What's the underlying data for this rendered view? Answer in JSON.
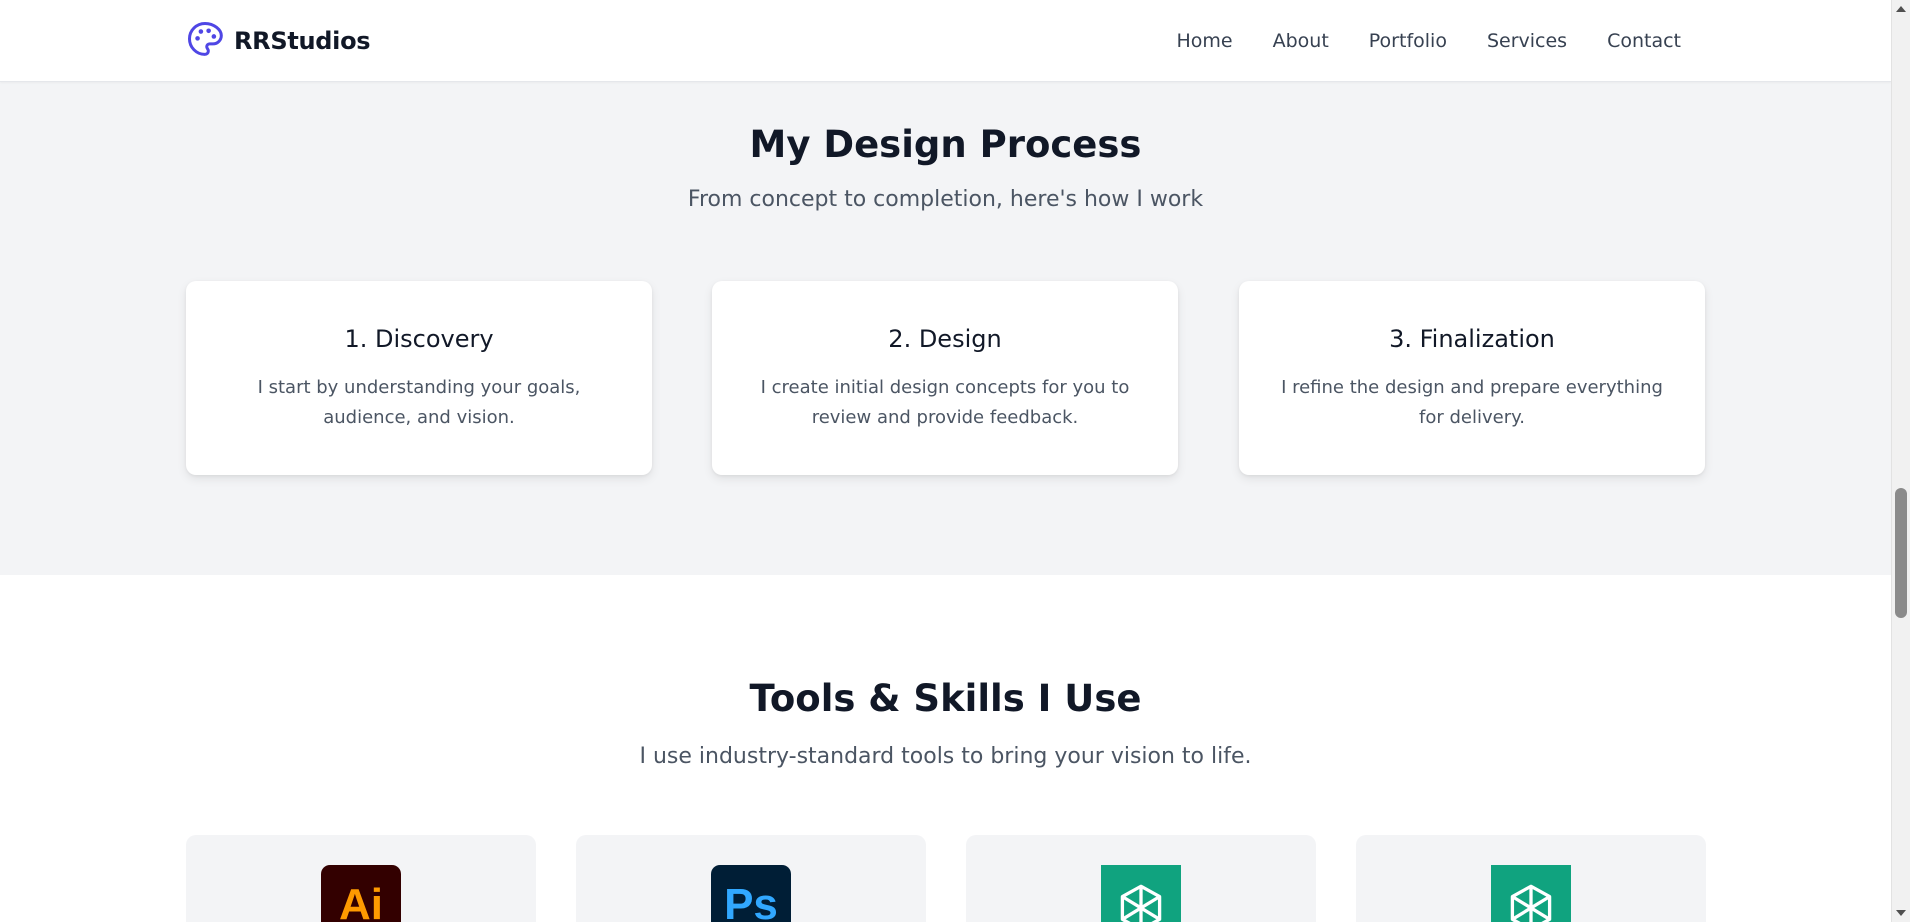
{
  "brand": {
    "name": "RRStudios",
    "icon": "palette-icon",
    "accent": "#4f46e5"
  },
  "nav": {
    "links": [
      "Home",
      "About",
      "Portfolio",
      "Services",
      "Contact"
    ]
  },
  "process": {
    "title": "My Design Process",
    "subtitle": "From concept to completion, here's how I work",
    "steps": [
      {
        "title": "1. Discovery",
        "text": "I start by understanding your goals, audience, and vision."
      },
      {
        "title": "2. Design",
        "text": "I create initial design concepts for you to review and provide feedback."
      },
      {
        "title": "3. Finalization",
        "text": "I refine the design and prepare everything for delivery."
      }
    ]
  },
  "tools": {
    "title": "Tools & Skills I Use",
    "subtitle": "I use industry-standard tools to bring your vision to life.",
    "items": [
      {
        "logo_text": "Ai",
        "icon": "adobe-illustrator-icon",
        "bg": "#330000",
        "fg": "#ff9a00"
      },
      {
        "logo_text": "Ps",
        "icon": "adobe-photoshop-icon",
        "bg": "#001e36",
        "fg": "#31a8ff"
      },
      {
        "icon": "chatgpt-icon",
        "bg": "#10a37f"
      },
      {
        "icon": "chatgpt-icon",
        "bg": "#10a37f"
      }
    ]
  }
}
